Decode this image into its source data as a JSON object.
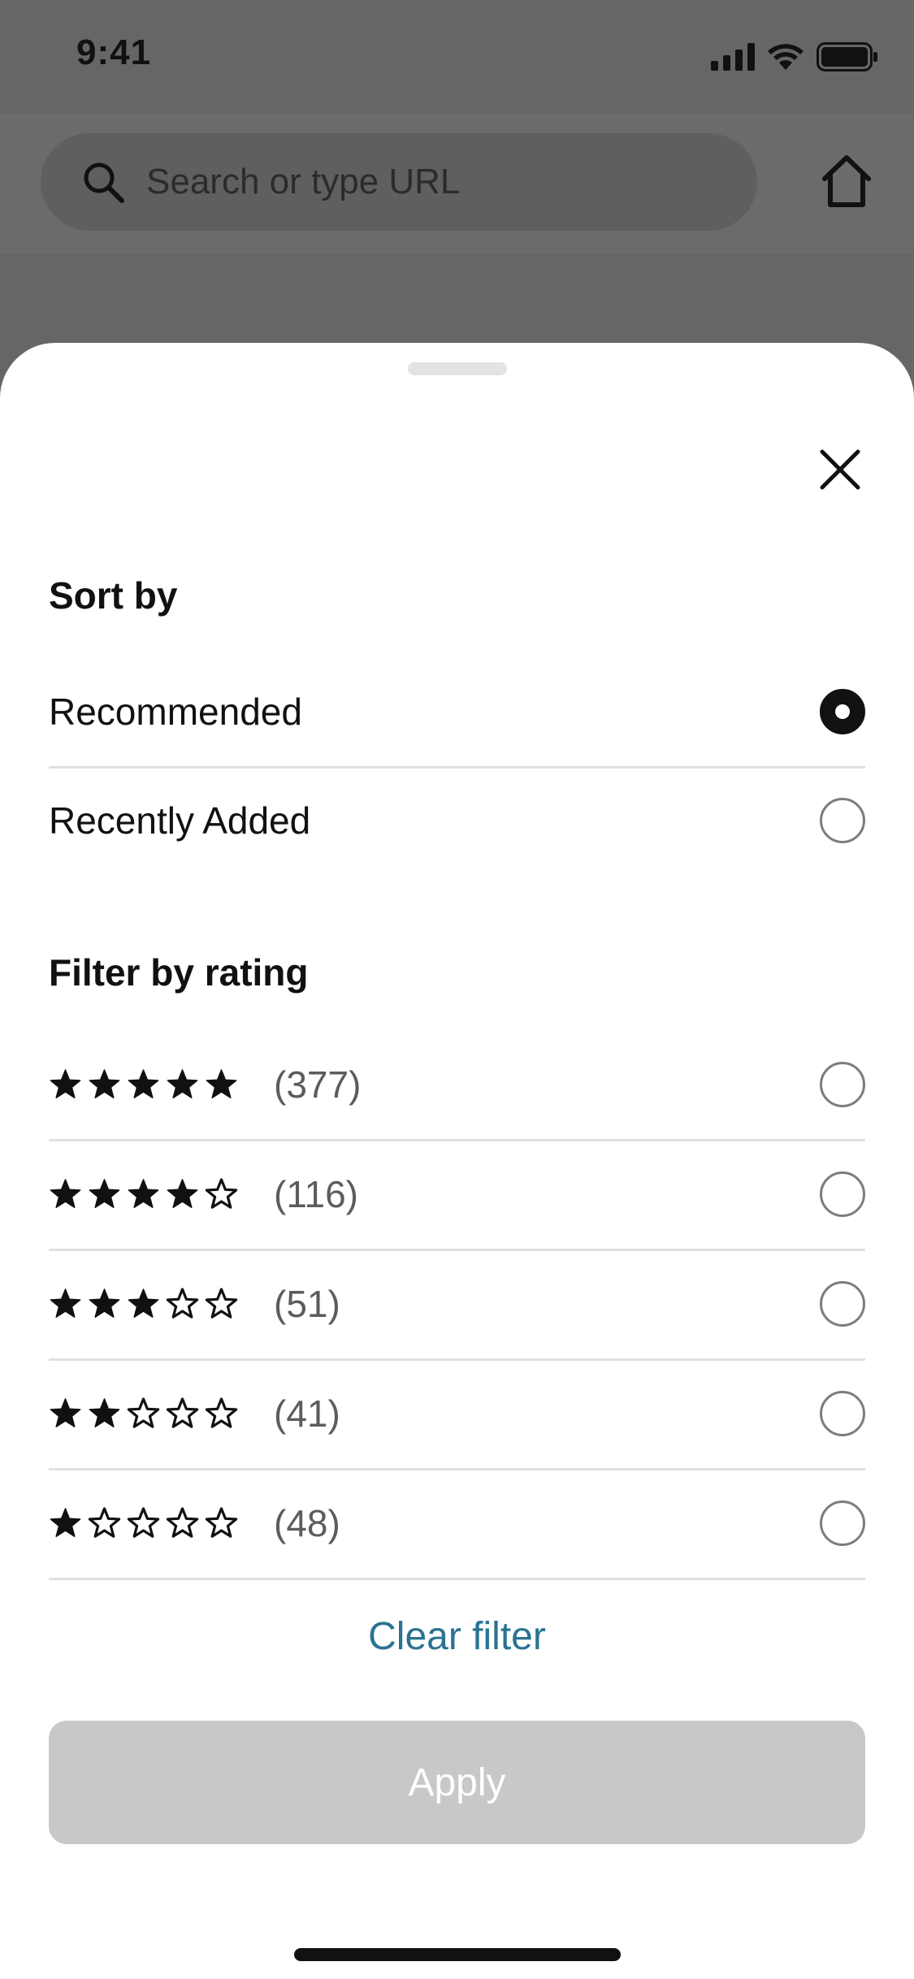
{
  "status_bar": {
    "time": "9:41",
    "icons": [
      "cellular-signal-icon",
      "wifi-icon",
      "battery-icon"
    ]
  },
  "browser": {
    "url_placeholder": "Search or type URL",
    "icons": [
      "search-icon",
      "home-icon"
    ]
  },
  "sheet": {
    "close_icon": "close-icon",
    "sort": {
      "title": "Sort by",
      "options": [
        {
          "label": "Recommended",
          "selected": true
        },
        {
          "label": "Recently Added",
          "selected": false
        }
      ]
    },
    "rating_filter": {
      "title": "Filter by rating",
      "options": [
        {
          "stars": 5,
          "count": "(377)",
          "selected": false
        },
        {
          "stars": 4,
          "count": "(116)",
          "selected": false
        },
        {
          "stars": 3,
          "count": "(51)",
          "selected": false
        },
        {
          "stars": 2,
          "count": "(41)",
          "selected": false
        },
        {
          "stars": 1,
          "count": "(48)",
          "selected": false
        }
      ]
    },
    "clear_filter": "Clear filter",
    "apply": "Apply"
  },
  "colors": {
    "accent_link": "#2a7391",
    "apply_disabled_bg": "#c8c8c8",
    "scrim": "#666666"
  }
}
